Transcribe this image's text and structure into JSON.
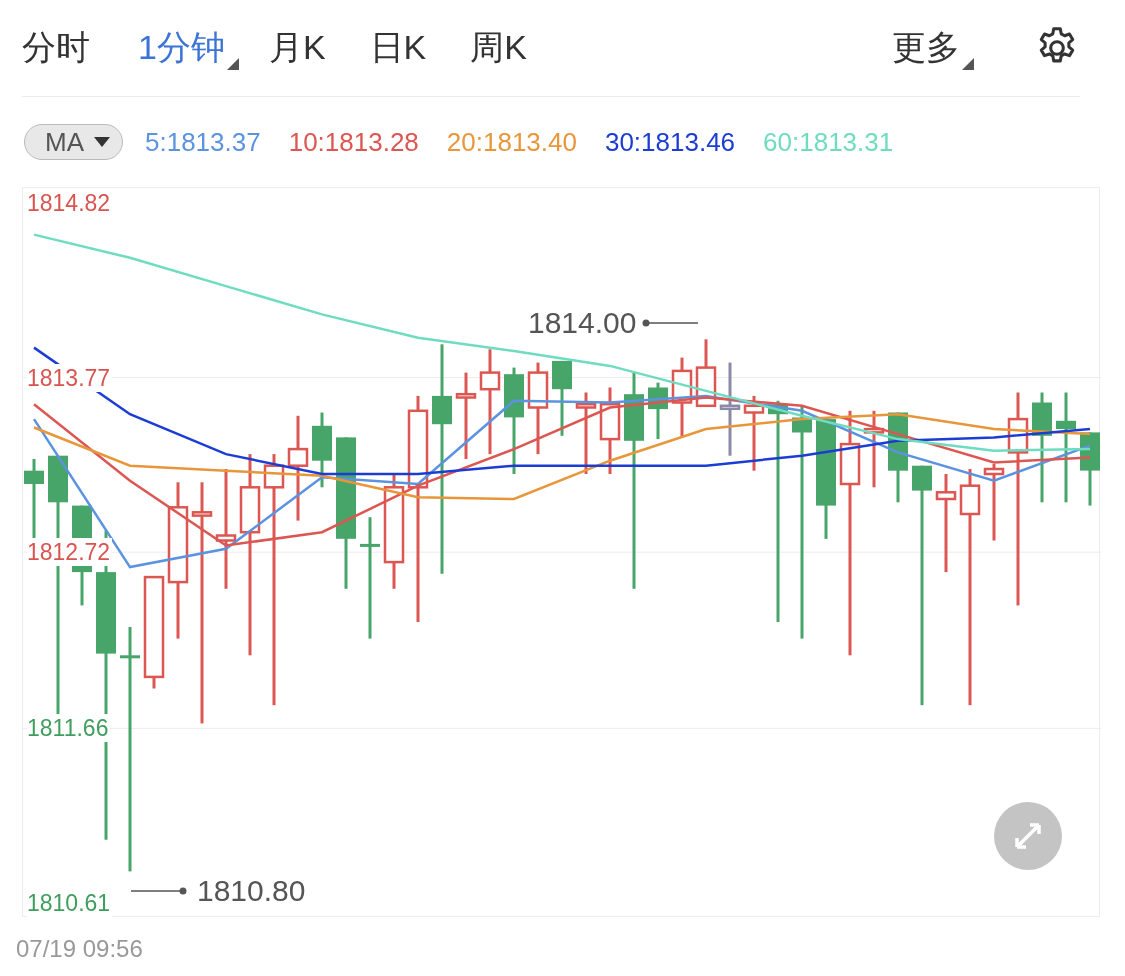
{
  "tabs": [
    {
      "label": "分时",
      "selected": false,
      "dropdown": false
    },
    {
      "label": "1分钟",
      "selected": true,
      "dropdown": true
    },
    {
      "label": "月K",
      "selected": false,
      "dropdown": false
    },
    {
      "label": "日K",
      "selected": false,
      "dropdown": false
    },
    {
      "label": "周K",
      "selected": false,
      "dropdown": false
    }
  ],
  "more": {
    "label": "更多",
    "dropdown": true
  },
  "indicator": {
    "label": "MA"
  },
  "chart": {
    "high_marker": "1814.00",
    "low_marker": "1810.80",
    "y_labels": [
      {
        "color": "#d9534f"
      },
      {
        "color": "#d9534f"
      },
      {
        "color": "#d9534f"
      },
      {
        "color": "#3f9e5e"
      },
      {
        "color": "#3f9e5e"
      }
    ],
    "chart_data": {
      "type": "line",
      "ylim": [
        1810.52,
        1814.91
      ],
      "grid": true,
      "yticks": [
        {
          "value": 1814.82,
          "label": "1814.82"
        },
        {
          "value": 1813.77,
          "label": "1813.77"
        },
        {
          "value": 1812.72,
          "label": "1812.72"
        },
        {
          "value": 1811.66,
          "label": "1811.66"
        },
        {
          "value": 1810.61,
          "label": "1810.61"
        }
      ],
      "series": [
        {
          "name": "5:1813.37",
          "color": "#5b93e0",
          "values": [
            1813.52,
            1812.63,
            1812.74,
            1813.17,
            1813.13,
            1813.63,
            1813.62,
            1813.66,
            1813.57,
            1813.32,
            1813.15,
            1813.36
          ]
        },
        {
          "name": "10:1813.28",
          "color": "#dc5652",
          "values": [
            1813.61,
            1813.15,
            1812.76,
            1812.84,
            1813.12,
            1813.34,
            1813.59,
            1813.65,
            1813.6,
            1813.43,
            1813.26,
            1813.29
          ]
        },
        {
          "name": "20:1813.40",
          "color": "#e8963a",
          "values": [
            1813.47,
            1813.24,
            1813.21,
            1813.18,
            1813.05,
            1813.04,
            1813.27,
            1813.46,
            1813.52,
            1813.55,
            1813.46,
            1813.43
          ]
        },
        {
          "name": "30:1813.46",
          "color": "#1c3dd4",
          "values": [
            1813.95,
            1813.55,
            1813.31,
            1813.19,
            1813.19,
            1813.24,
            1813.24,
            1813.24,
            1813.3,
            1813.39,
            1813.41,
            1813.46
          ]
        },
        {
          "name": "60:1813.31",
          "color": "#6fdcc0",
          "values": [
            1814.63,
            1814.49,
            1814.32,
            1814.15,
            1814.01,
            1813.93,
            1813.84,
            1813.69,
            1813.54,
            1813.4,
            1813.33,
            1813.34
          ]
        }
      ]
    }
  },
  "timestamp": "07/19 09:56"
}
